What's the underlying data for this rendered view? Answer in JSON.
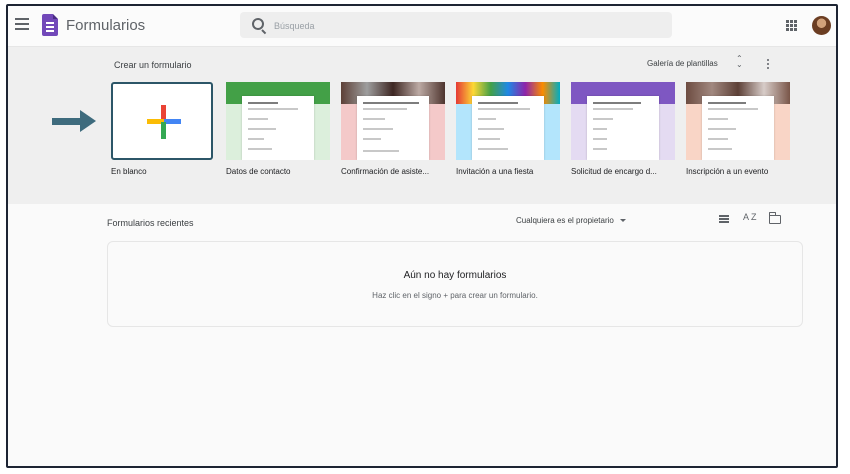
{
  "header": {
    "app_title": "Formularios",
    "search_placeholder": "Búsqueda"
  },
  "templates": {
    "section_title": "Crear un formulario",
    "gallery_label": "Galería de plantillas",
    "items": [
      {
        "label": "En blanco"
      },
      {
        "label": "Datos de contacto",
        "color": "#4caf50"
      },
      {
        "label": "Confirmación de asiste...",
        "color": "#ef9a9a"
      },
      {
        "label": "Invitación a una fiesta",
        "color": "#81d4fa"
      },
      {
        "label": "Solicitud de encargo d...",
        "color": "#7e57c2"
      },
      {
        "label": "Inscripción a un evento",
        "color": "#f4511e"
      }
    ]
  },
  "recent": {
    "title": "Formularios recientes",
    "owner_filter": "Cualquiera es el propietario",
    "sort_icon_text": "A Z",
    "empty_title": "Aún no hay formularios",
    "empty_subtitle": "Haz clic en el signo + para crear un formulario."
  }
}
